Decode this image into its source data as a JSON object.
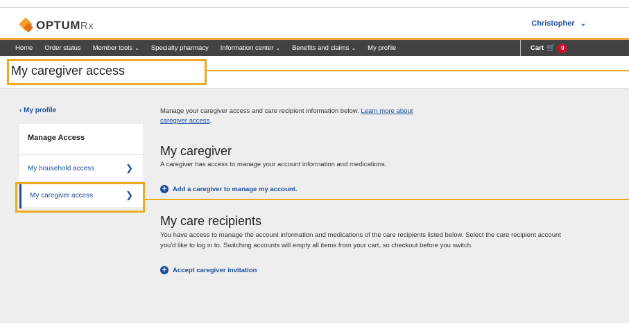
{
  "header": {
    "brand": "OPTUM",
    "brand_suffix": "Rx",
    "user_name": "Christopher",
    "user_chevron": "⌄"
  },
  "nav": {
    "items": [
      {
        "label": "Home",
        "dropdown": false
      },
      {
        "label": "Order status",
        "dropdown": false
      },
      {
        "label": "Member tools",
        "dropdown": true
      },
      {
        "label": "Specialty pharmacy",
        "dropdown": false
      },
      {
        "label": "Information center",
        "dropdown": true
      },
      {
        "label": "Benefits and claims",
        "dropdown": true
      },
      {
        "label": "My profile",
        "dropdown": false
      }
    ],
    "cart_label": "Cart",
    "cart_count": "0"
  },
  "page": {
    "title": "My caregiver access"
  },
  "sidebar": {
    "back_link": "‹ My profile",
    "heading": "Manage Access",
    "items": [
      {
        "label": "My household access",
        "active": false
      },
      {
        "label": "My caregiver access",
        "active": true
      }
    ]
  },
  "content": {
    "intro_text": "Manage your caregiver access and care recipient information below. ",
    "intro_link": "Learn more about caregiver access",
    "intro_end": ".",
    "caregiver": {
      "heading": "My caregiver",
      "description": "A caregiver has access to manage your account information and medications.",
      "action": "Add a caregiver to manage my account."
    },
    "recipients": {
      "heading": "My care recipients",
      "description": "You have access to manage the account information and medications of the care recipients listed below. Select the care recipient account you'd like to log in to. Switching accounts will empty all items from your cart, so checkout before you switch.",
      "action": "Accept caregiver invitation"
    }
  },
  "colors": {
    "highlight": "#f0a91e",
    "link": "#1b4f9c",
    "navbar": "#424242",
    "nav_accent": "#f3a23b",
    "badge": "#c8102e"
  }
}
